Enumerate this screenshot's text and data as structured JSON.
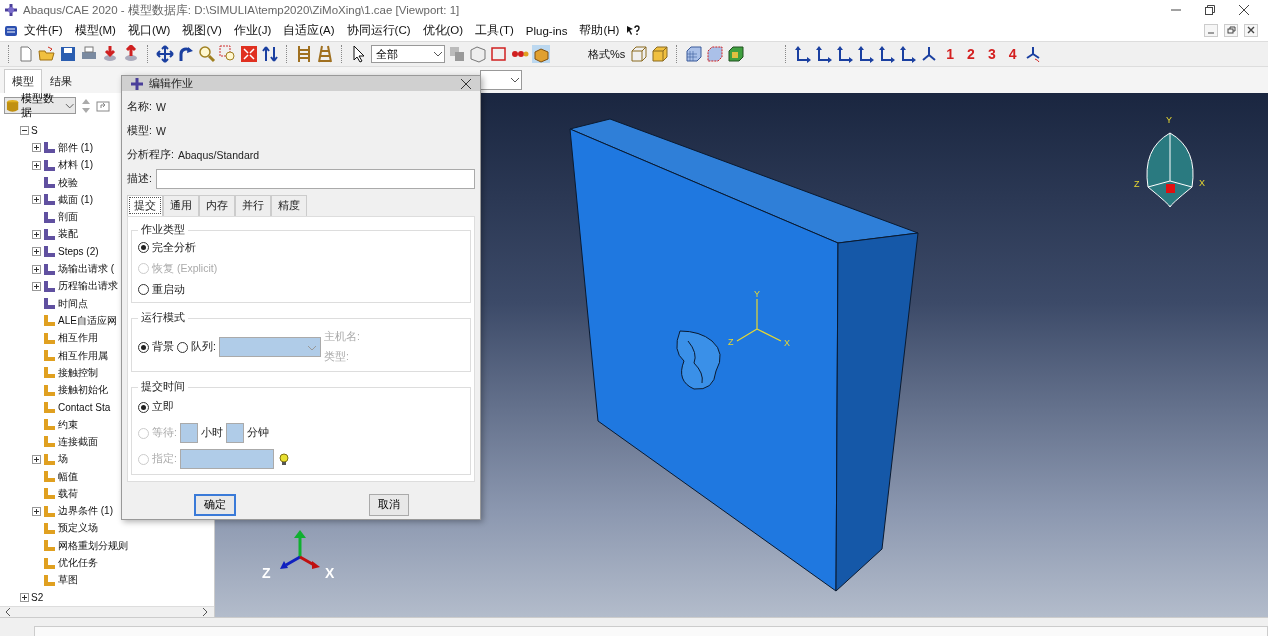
{
  "window": {
    "title": "Abaqus/CAE 2020 - 模型数据库: D:\\SIMULIA\\temp2020\\ZiMoXing\\1.cae [Viewport: 1]"
  },
  "menu": [
    "文件(F)",
    "模型(M)",
    "视口(W)",
    "视图(V)",
    "作业(J)",
    "自适应(A)",
    "协同运行(C)",
    "优化(O)",
    "工具(T)",
    "Plug-ins",
    "帮助(H)"
  ],
  "toolbar": {
    "selection_filter": "全部",
    "format_label": "格式%s",
    "view_numbers": [
      "1",
      "2",
      "3",
      "4"
    ]
  },
  "panel": {
    "tabs": [
      {
        "label": "模型",
        "selected": true
      },
      {
        "label": "结果",
        "selected": false
      }
    ],
    "database_selector": "模型数据"
  },
  "tree": [
    {
      "label": "S",
      "expandable": true,
      "expanded": true,
      "children": [
        {
          "label": "部件 (1)",
          "expandable": true
        },
        {
          "label": "材料 (1)",
          "expandable": true
        },
        {
          "label": "校验",
          "expandable": false
        },
        {
          "label": "截面 (1)",
          "expandable": true
        },
        {
          "label": "剖面",
          "expandable": false
        },
        {
          "label": "装配",
          "expandable": true
        },
        {
          "label": "Steps (2)",
          "expandable": true
        },
        {
          "label": "场输出请求 (",
          "expandable": true
        },
        {
          "label": "历程输出请求",
          "expandable": true
        },
        {
          "label": "时间点",
          "expandable": false
        },
        {
          "label": "ALE自适应网",
          "expandable": false
        },
        {
          "label": "相互作用",
          "expandable": false
        },
        {
          "label": "相互作用属",
          "expandable": false
        },
        {
          "label": "接触控制",
          "expandable": false
        },
        {
          "label": "接触初始化",
          "expandable": false
        },
        {
          "label": "Contact Sta",
          "expandable": false
        },
        {
          "label": "约束",
          "expandable": false
        },
        {
          "label": "连接截面",
          "expandable": false
        },
        {
          "label": "场",
          "expandable": true
        },
        {
          "label": "幅值",
          "expandable": false
        },
        {
          "label": "载荷",
          "expandable": false
        },
        {
          "label": "边界条件 (1)",
          "expandable": true
        },
        {
          "label": "预定义场",
          "expandable": false
        },
        {
          "label": "网格重划分规则",
          "expandable": false
        },
        {
          "label": "优化任务",
          "expandable": false
        },
        {
          "label": "草图",
          "expandable": false
        }
      ]
    },
    {
      "label": "S2",
      "expandable": true,
      "expanded": false
    }
  ],
  "dialog": {
    "title": "编辑作业",
    "fields": [
      {
        "label": "名称:",
        "value": "W"
      },
      {
        "label": "模型:",
        "value": "W"
      },
      {
        "label": "分析程序:",
        "value": "Abaqus/Standard"
      }
    ],
    "description_label": "描述:",
    "tabs": [
      {
        "label": "提交",
        "selected": true
      },
      {
        "label": "通用",
        "selected": false
      },
      {
        "label": "内存",
        "selected": false
      },
      {
        "label": "并行",
        "selected": false
      },
      {
        "label": "精度",
        "selected": false
      }
    ],
    "job_type": {
      "title": "作业类型",
      "options": [
        {
          "label": "完全分析",
          "selected": true,
          "disabled": false
        },
        {
          "label": "恢复 (Explicit)",
          "selected": false,
          "disabled": true
        },
        {
          "label": "重启动",
          "selected": false,
          "disabled": false
        }
      ]
    },
    "run_mode": {
      "title": "运行模式",
      "options": [
        {
          "label": "背景",
          "selected": true
        },
        {
          "label": "队列:",
          "selected": false
        }
      ],
      "queue_disabled": true,
      "host_label": "主机名:",
      "type_label": "类型:"
    },
    "submit_time": {
      "title": "提交时间",
      "options": [
        {
          "kind": "now",
          "label": "立即",
          "selected": true,
          "disabled": false
        },
        {
          "kind": "wait",
          "label": "等待:",
          "selected": false,
          "disabled": true,
          "hours_unit": "小时",
          "minutes_unit": "分钟"
        },
        {
          "kind": "at",
          "label": "指定:",
          "selected": false,
          "disabled": true
        }
      ]
    },
    "buttons": [
      {
        "label": "确定",
        "default": true
      },
      {
        "label": "取消",
        "default": false
      }
    ]
  },
  "viewport": {
    "part_triad": [
      "Y",
      "Z",
      "X"
    ],
    "view_triad": [
      "Y",
      "Z",
      "X"
    ],
    "global_triad": [
      "Z",
      "X"
    ]
  }
}
